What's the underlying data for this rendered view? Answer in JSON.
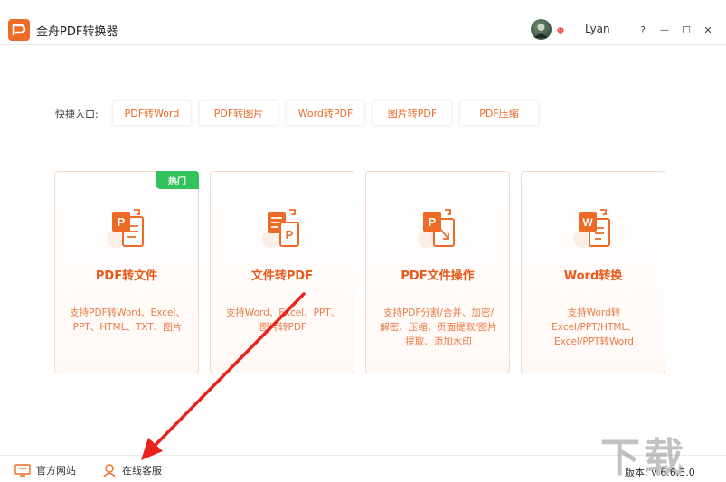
{
  "app": {
    "title": "金舟PDF转换器",
    "username": "Lyan",
    "accent_color": "#ee6a27"
  },
  "window_controls": {
    "help": "?",
    "minimize": "—",
    "maximize": "☐",
    "close": "✕"
  },
  "quick_entry": {
    "label": "快捷入口:",
    "buttons": [
      "PDF转Word",
      "PDF转图片",
      "Word转PDF",
      "图片转PDF",
      "PDF压缩"
    ]
  },
  "cards": [
    {
      "title": "PDF转文件",
      "badge": "热门",
      "desc": "支持PDF转Word、Excel、PPT、HTML、TXT、图片",
      "icon": "pdf-to-file-icon"
    },
    {
      "title": "文件转PDF",
      "desc": "支持Word、Excel、PPT、图片转PDF",
      "icon": "file-to-pdf-icon"
    },
    {
      "title": "PDF文件操作",
      "desc": "支持PDF分割/合并、加密/解密、压缩、页面提取/图片提取、添加水印",
      "icon": "pdf-operation-icon"
    },
    {
      "title": "Word转换",
      "desc": "支持Word转Excel/PPT/HTML、Excel/PPT转Word",
      "icon": "word-convert-icon"
    }
  ],
  "footer": {
    "website": "官方网站",
    "support": "在线客服",
    "version": "版本: v 6.6.3.0"
  }
}
